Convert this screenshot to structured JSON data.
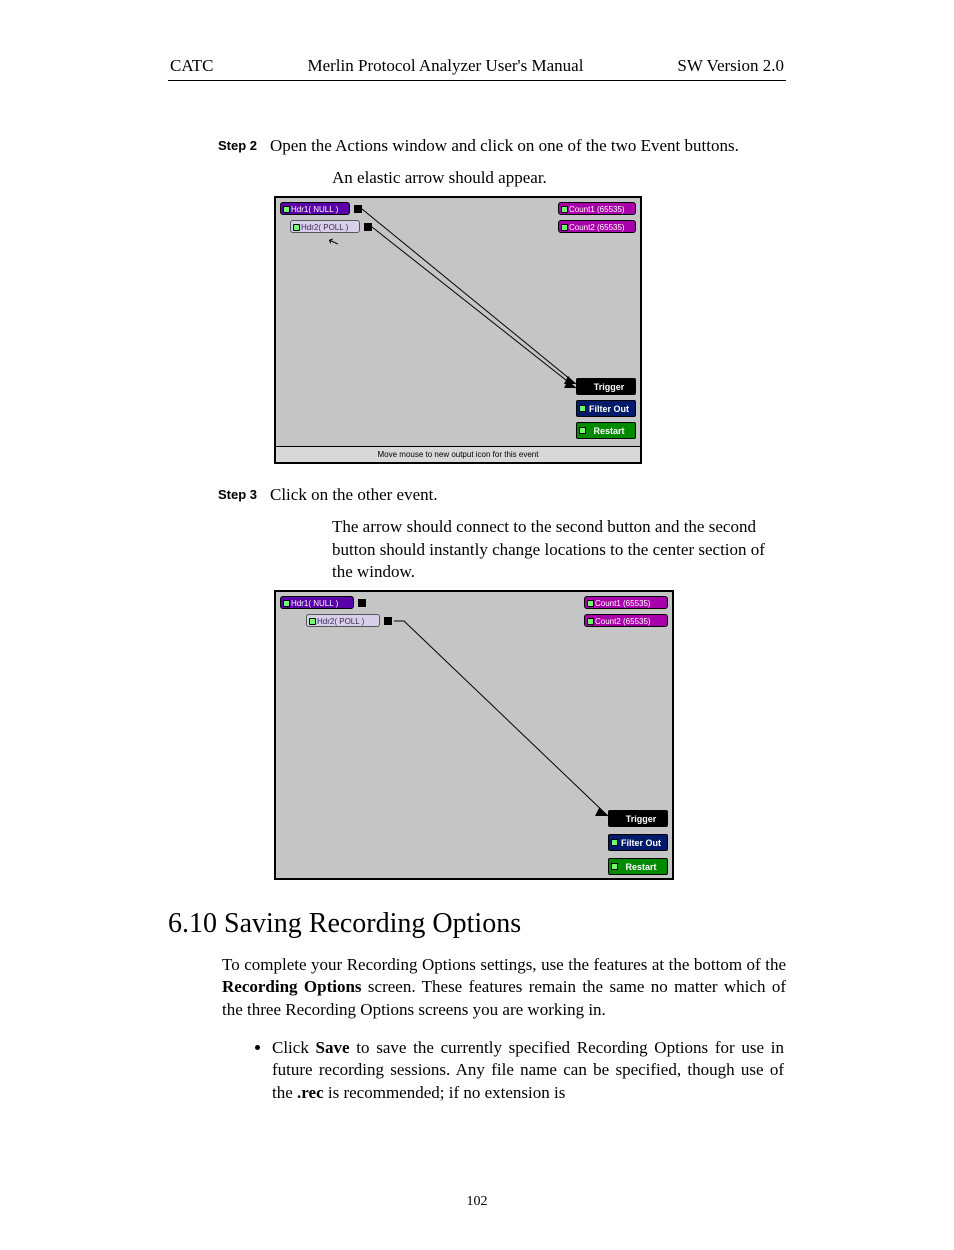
{
  "header": {
    "left": "CATC",
    "center": "Merlin Protocol Analyzer User's Manual",
    "right": "SW Version 2.0"
  },
  "step2": {
    "label": "Step 2",
    "text": "Open the Actions window and click on one of the two Event buttons.",
    "note": "An elastic arrow should appear."
  },
  "diagram1": {
    "hdr1": "Hdr1( NULL )",
    "hdr2": "Hdr2( POLL )",
    "count1": "Count1 (65535)",
    "count2": "Count2 (65535)",
    "trigger": "Trigger",
    "filter": "Filter Out",
    "restart": "Restart",
    "status": "Move mouse to new output icon for this event"
  },
  "step3": {
    "label": "Step 3",
    "text": "Click on the other event.",
    "note": "The arrow should connect to the second button and the second button should instantly change locations to the center section of the window."
  },
  "diagram2": {
    "hdr1": "Hdr1( NULL )",
    "hdr2": "Hdr2( POLL )",
    "count1": "Count1 (65535)",
    "count2": "Count2 (65535)",
    "trigger": "Trigger",
    "filter": "Filter Out",
    "restart": "Restart"
  },
  "section": {
    "title": "6.10  Saving Recording Options",
    "para_pre": "To complete your Recording Options settings, use the features at the bottom of the ",
    "para_bold": "Recording Options",
    "para_post": " screen. These features remain the same no matter which of the three Recording Options screens you are working in.",
    "bullet_pre": "Click ",
    "bullet_b1": "Save",
    "bullet_mid": " to save the currently specified Recording Options for use in future recording sessions. Any file name can be specified, though use of the ",
    "bullet_b2": ".rec",
    "bullet_post": " is recommended; if no extension is"
  },
  "page_number": "102"
}
